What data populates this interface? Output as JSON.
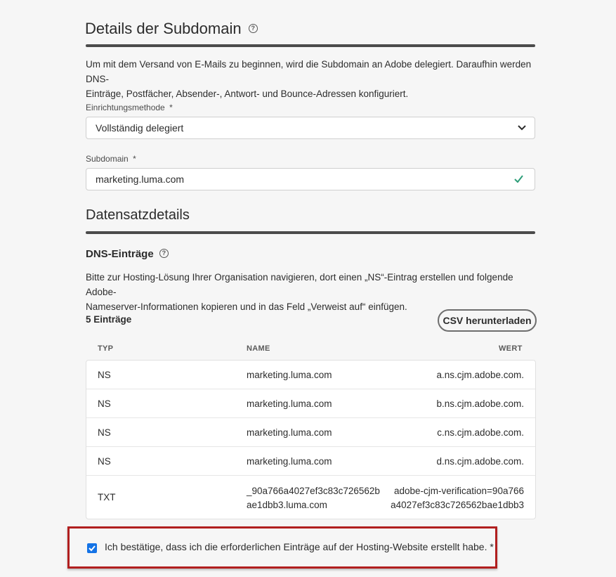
{
  "subdomain_section": {
    "title": "Details der Subdomain",
    "description_line1": "Um mit dem Versand von E-Mails zu beginnen, wird die Subdomain an Adobe delegiert. Daraufhin werden DNS-",
    "description_line2": "Einträge, Postfächer, Absender-, Antwort- und Bounce-Adressen konfiguriert.",
    "setup_method": {
      "label": "Einrichtungsmethode",
      "required_mark": "*",
      "value": "Vollständig delegiert"
    },
    "subdomain": {
      "label": "Subdomain",
      "required_mark": "*",
      "value": "marketing.luma.com"
    }
  },
  "record_section": {
    "title": "Datensatzdetails",
    "dns_title": "DNS-Einträge",
    "instructions_line1": "Bitte zur Hosting-Lösung Ihrer Organisation navigieren, dort einen „NS“-Eintrag erstellen und folgende Adobe-",
    "instructions_line2": "Nameserver-Informationen kopieren und in das Feld „Verweist auf“ einfügen.",
    "entry_count": "5 Einträge",
    "csv_button": "CSV herunterladen",
    "columns": {
      "type": "TYP",
      "name": "NAME",
      "value": "WERT"
    },
    "rows": [
      {
        "type": "NS",
        "name": "marketing.luma.com",
        "value": "a.ns.cjm.adobe.com."
      },
      {
        "type": "NS",
        "name": "marketing.luma.com",
        "value": "b.ns.cjm.adobe.com."
      },
      {
        "type": "NS",
        "name": "marketing.luma.com",
        "value": "c.ns.cjm.adobe.com."
      },
      {
        "type": "NS",
        "name": "marketing.luma.com",
        "value": "d.ns.cjm.adobe.com."
      },
      {
        "type": "TXT",
        "name_line1": "_90a766a4027ef3c83c726562b",
        "name_line2": "ae1dbb3.luma.com",
        "value_line1": "adobe-cjm-verification=90a766",
        "value_line2": "a4027ef3c83c726562bae1dbb3"
      }
    ]
  },
  "confirmation": {
    "checked": true,
    "label": "Ich bestätige, dass ich die erforderlichen Einträge auf der Hosting-Website erstellt habe. *"
  },
  "colors": {
    "accent": "#1473e6",
    "success": "#2d9d78",
    "highlight_border": "#b11f1f"
  }
}
